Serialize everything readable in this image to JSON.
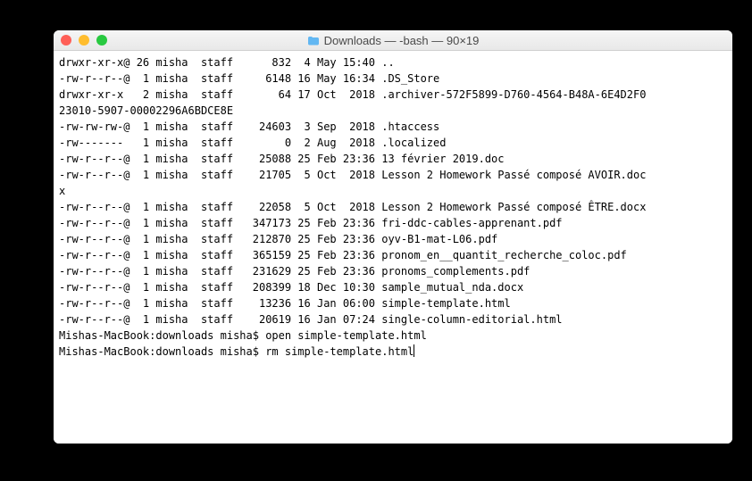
{
  "window": {
    "title": "Downloads — -bash — 90×19",
    "icon": "folder-icon"
  },
  "listing": [
    {
      "perm": "drwxr-xr-x@",
      "links": "26",
      "user": "misha",
      "group": "staff",
      "size": "832",
      "date": " 4 May 15:40",
      "name": ".."
    },
    {
      "perm": "-rw-r--r--@",
      "links": " 1",
      "user": "misha",
      "group": "staff",
      "size": "6148",
      "date": "16 May 16:34",
      "name": ".DS_Store"
    },
    {
      "perm": "drwxr-xr-x ",
      "links": " 2",
      "user": "misha",
      "group": "staff",
      "size": "64",
      "date": "17 Oct  2018",
      "name": ".archiver-572F5899-D760-4564-B48A-6E4D2F0"
    },
    {
      "wrap": "23010-5907-00002296A6BDCE8E"
    },
    {
      "perm": "-rw-rw-rw-@",
      "links": " 1",
      "user": "misha",
      "group": "staff",
      "size": "24603",
      "date": " 3 Sep  2018",
      "name": ".htaccess"
    },
    {
      "perm": "-rw------- ",
      "links": " 1",
      "user": "misha",
      "group": "staff",
      "size": "0",
      "date": " 2 Aug  2018",
      "name": ".localized"
    },
    {
      "perm": "-rw-r--r--@",
      "links": " 1",
      "user": "misha",
      "group": "staff",
      "size": "25088",
      "date": "25 Feb 23:36",
      "name": "13 février 2019.doc"
    },
    {
      "perm": "-rw-r--r--@",
      "links": " 1",
      "user": "misha",
      "group": "staff",
      "size": "21705",
      "date": " 5 Oct  2018",
      "name": "Lesson 2 Homework Passé composé AVOIR.doc"
    },
    {
      "wrap": "x"
    },
    {
      "perm": "-rw-r--r--@",
      "links": " 1",
      "user": "misha",
      "group": "staff",
      "size": "22058",
      "date": " 5 Oct  2018",
      "name": "Lesson 2 Homework Passé composé ÊTRE.docx"
    },
    {
      "perm": "-rw-r--r--@",
      "links": " 1",
      "user": "misha",
      "group": "staff",
      "size": "347173",
      "date": "25 Feb 23:36",
      "name": "fri-ddc-cables-apprenant.pdf"
    },
    {
      "perm": "-rw-r--r--@",
      "links": " 1",
      "user": "misha",
      "group": "staff",
      "size": "212870",
      "date": "25 Feb 23:36",
      "name": "oyv-B1-mat-L06.pdf"
    },
    {
      "perm": "-rw-r--r--@",
      "links": " 1",
      "user": "misha",
      "group": "staff",
      "size": "365159",
      "date": "25 Feb 23:36",
      "name": "pronom_en__quantit_recherche_coloc.pdf"
    },
    {
      "perm": "-rw-r--r--@",
      "links": " 1",
      "user": "misha",
      "group": "staff",
      "size": "231629",
      "date": "25 Feb 23:36",
      "name": "pronoms_complements.pdf"
    },
    {
      "perm": "-rw-r--r--@",
      "links": " 1",
      "user": "misha",
      "group": "staff",
      "size": "208399",
      "date": "18 Dec 10:30",
      "name": "sample_mutual_nda.docx"
    },
    {
      "perm": "-rw-r--r--@",
      "links": " 1",
      "user": "misha",
      "group": "staff",
      "size": "13236",
      "date": "16 Jan 06:00",
      "name": "simple-template.html"
    },
    {
      "perm": "-rw-r--r--@",
      "links": " 1",
      "user": "misha",
      "group": "staff",
      "size": "20619",
      "date": "16 Jan 07:24",
      "name": "single-column-editorial.html"
    }
  ],
  "prompts": [
    {
      "prompt": "Mishas-MacBook:downloads misha$ ",
      "cmd": "open simple-template.html"
    },
    {
      "prompt": "Mishas-MacBook:downloads misha$ ",
      "cmd": "rm simple-template.html",
      "cursor": true
    }
  ]
}
